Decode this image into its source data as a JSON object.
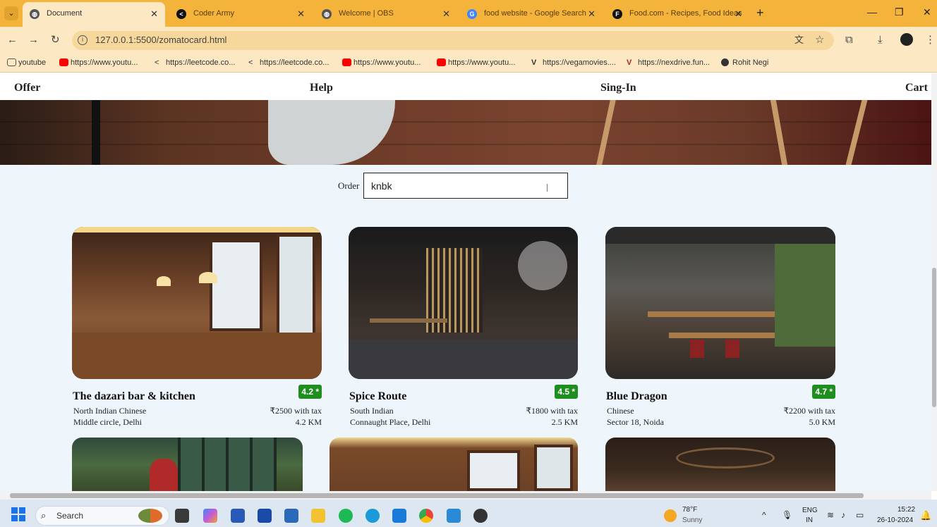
{
  "browser": {
    "tabs": [
      {
        "title": "Document",
        "icon": "globe-icon",
        "color": "#555555",
        "active": true
      },
      {
        "title": "Coder Army",
        "icon": "coder-army-icon",
        "color": "#111111",
        "active": false
      },
      {
        "title": "Welcome | OBS",
        "icon": "globe-icon",
        "color": "#555555",
        "active": false
      },
      {
        "title": "food website - Google Search",
        "icon": "google-icon",
        "color": "#4285f4",
        "active": false
      },
      {
        "title": "Food.com - Recipes, Food Ideas",
        "icon": "food-com-icon",
        "color": "#111111",
        "active": false
      }
    ],
    "url": "127.0.0.1:5500/zomatocard.html",
    "bookmarks": [
      {
        "label": "youtube",
        "icon": "folder-icon",
        "color": "#ffffff"
      },
      {
        "label": "https://www.youtu...",
        "icon": "youtube-icon",
        "color": "#ff0000"
      },
      {
        "label": "https://leetcode.co...",
        "icon": "leetcode-icon",
        "color": "#333333"
      },
      {
        "label": "https://leetcode.co...",
        "icon": "leetcode-icon",
        "color": "#333333"
      },
      {
        "label": "https://www.youtu...",
        "icon": "youtube-icon",
        "color": "#ff0000"
      },
      {
        "label": "https://www.youtu...",
        "icon": "youtube-icon",
        "color": "#ff0000"
      },
      {
        "label": "https://vegamovies....",
        "icon": "vegamovies-icon",
        "color": "#333333"
      },
      {
        "label": "https://nexdrive.fun...",
        "icon": "nexdrive-icon",
        "color": "#b22222"
      },
      {
        "label": "Rohit Negi",
        "icon": "globe-icon",
        "color": "#333333"
      }
    ]
  },
  "nav": {
    "offer": "Offer",
    "help": "Help",
    "signin": "Sing-In",
    "cart": "Cart"
  },
  "order": {
    "label": "Order",
    "value": "knbk"
  },
  "restaurants": [
    {
      "name": "The dazari bar & kitchen",
      "rating": "4.2 *",
      "cuisine": "North Indian Chinese",
      "price": "₹2500 with tax",
      "location": "Middle circle, Delhi",
      "distance": "4.2 KM"
    },
    {
      "name": "Spice Route",
      "rating": "4.5 *",
      "cuisine": "South Indian",
      "price": "₹1800 with tax",
      "location": "Connaught Place, Delhi",
      "distance": "2.5 KM"
    },
    {
      "name": "Blue Dragon",
      "rating": "4.7 *",
      "cuisine": "Chinese",
      "price": "₹2200 with tax",
      "location": "Sector 18, Noida",
      "distance": "5.0 KM"
    }
  ],
  "taskbar": {
    "search_label": "Search",
    "weather_temp": "78°F",
    "weather_cond": "Sunny",
    "lang1": "ENG",
    "lang2": "IN",
    "time": "15:22",
    "date": "26-10-2024"
  }
}
